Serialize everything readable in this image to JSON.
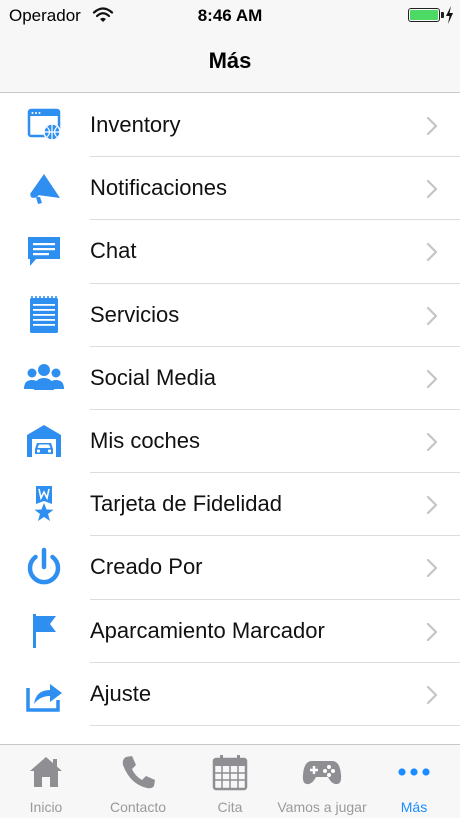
{
  "status_bar": {
    "carrier": "Operador",
    "time": "8:46 AM",
    "battery_level": 1.0,
    "battery_color": "#4cd964"
  },
  "nav": {
    "title": "Más"
  },
  "menu": {
    "items": [
      {
        "label": "Inventory",
        "icon": "web-globe-icon"
      },
      {
        "label": "Notificaciones",
        "icon": "megaphone-icon"
      },
      {
        "label": "Chat",
        "icon": "chat-bubble-icon"
      },
      {
        "label": "Servicios",
        "icon": "notepad-list-icon"
      },
      {
        "label": "Social Media",
        "icon": "people-group-icon"
      },
      {
        "label": "Mis coches",
        "icon": "garage-car-icon"
      },
      {
        "label": "Tarjeta de Fidelidad",
        "icon": "loyalty-badge-icon"
      },
      {
        "label": "Creado Por",
        "icon": "power-icon"
      },
      {
        "label": "Aparcamiento Marcador",
        "icon": "flag-icon"
      },
      {
        "label": "Ajuste",
        "icon": "share-arrow-icon"
      }
    ],
    "accent_color": "#2f8ff0"
  },
  "tabs": [
    {
      "label": "Inicio",
      "icon": "home-icon",
      "active": false
    },
    {
      "label": "Contacto",
      "icon": "phone-icon",
      "active": false
    },
    {
      "label": "Cita",
      "icon": "calendar-icon",
      "active": false
    },
    {
      "label": "Vamos a jugar",
      "icon": "gamepad-icon",
      "active": false
    },
    {
      "label": "Más",
      "icon": "more-dots-icon",
      "active": true
    }
  ]
}
